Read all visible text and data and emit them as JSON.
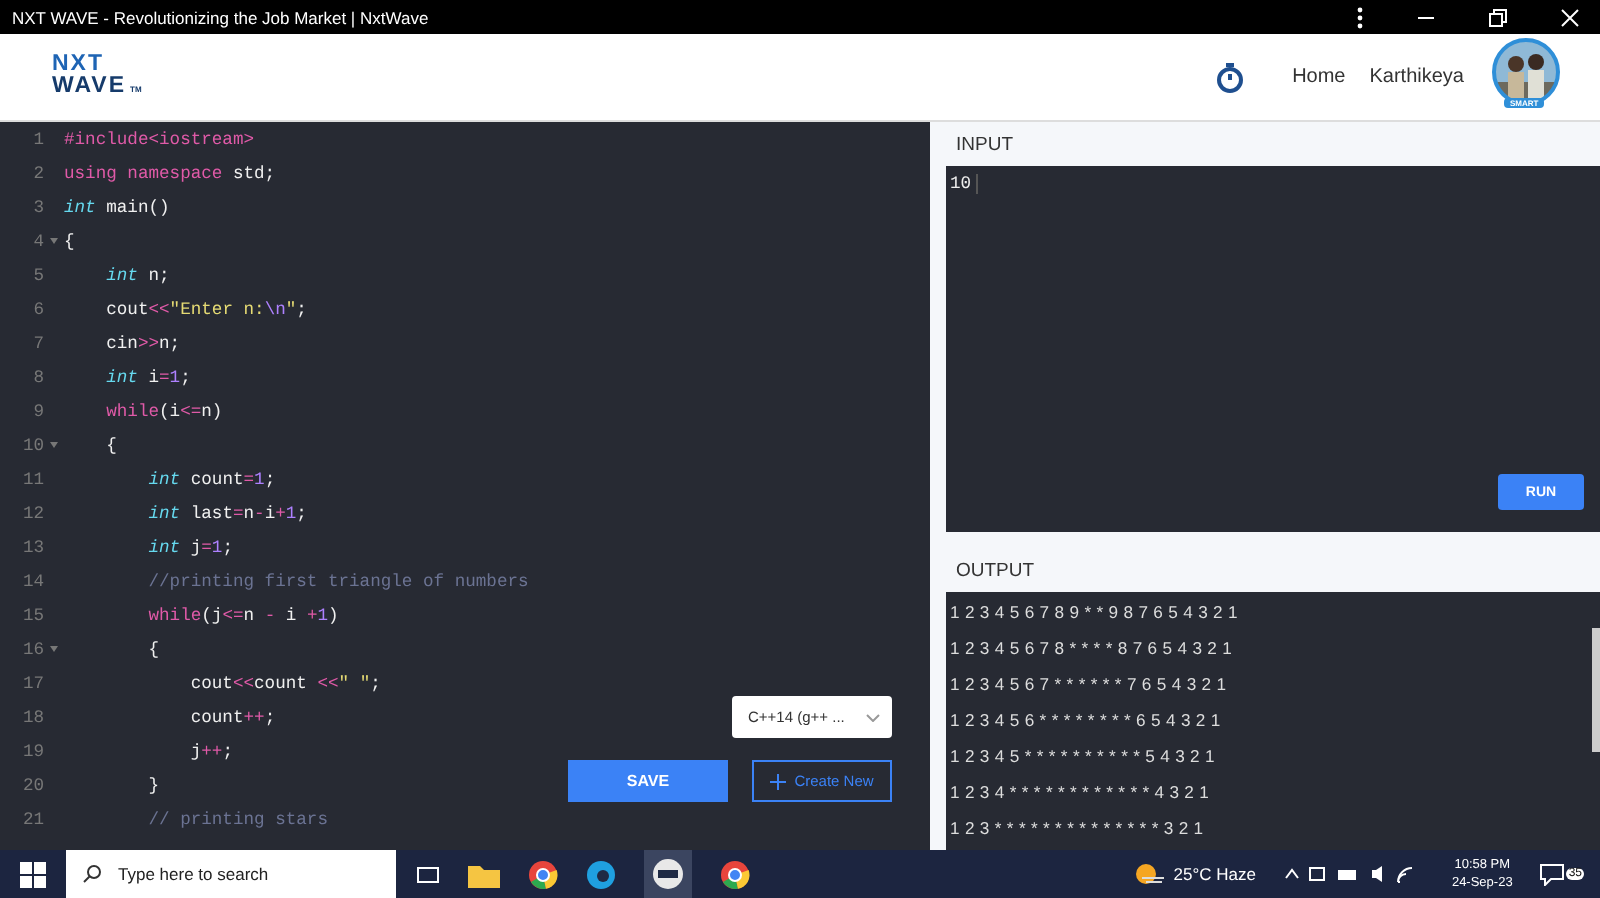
{
  "window": {
    "title": "NXT WAVE - Revolutionizing the Job Market | NxtWave"
  },
  "header": {
    "logo": {
      "line_1": "NXT",
      "line_2": "WAVE",
      "mark": "TM"
    },
    "nav": [
      "Home",
      "Karthikeya"
    ],
    "avatar": {
      "badge": "SMART"
    }
  },
  "editor": {
    "lines": [
      {
        "number": "1",
        "fold": false,
        "tokens": [
          {
            "kind": "pre",
            "t": "#include<iostream>"
          }
        ]
      },
      {
        "number": "2",
        "fold": false,
        "tokens": [
          {
            "kind": "kw",
            "t": "using namespace"
          },
          {
            "kind": "plain",
            "t": " std;"
          }
        ]
      },
      {
        "number": "3",
        "fold": false,
        "tokens": [
          {
            "kind": "type",
            "t": "int"
          },
          {
            "kind": "plain",
            "t": " main()"
          }
        ]
      },
      {
        "number": "4",
        "fold": true,
        "tokens": [
          {
            "kind": "plain",
            "t": "{"
          }
        ]
      },
      {
        "number": "5",
        "fold": false,
        "tokens": [
          {
            "kind": "type",
            "t": "    int"
          },
          {
            "kind": "plain",
            "t": " n;"
          }
        ]
      },
      {
        "number": "6",
        "fold": false,
        "tokens": [
          {
            "kind": "plain",
            "t": "    cout"
          },
          {
            "kind": "op",
            "t": "<<"
          },
          {
            "kind": "str",
            "t": "\"Enter n:"
          },
          {
            "kind": "esc",
            "t": "\\n"
          },
          {
            "kind": "str",
            "t": "\""
          },
          {
            "kind": "plain",
            "t": ";"
          }
        ]
      },
      {
        "number": "7",
        "fold": false,
        "tokens": [
          {
            "kind": "plain",
            "t": "    cin"
          },
          {
            "kind": "op",
            "t": ">>"
          },
          {
            "kind": "plain",
            "t": "n;"
          }
        ]
      },
      {
        "number": "8",
        "fold": false,
        "tokens": [
          {
            "kind": "type",
            "t": "    int"
          },
          {
            "kind": "plain",
            "t": " i"
          },
          {
            "kind": "op",
            "t": "="
          },
          {
            "kind": "num",
            "t": "1"
          },
          {
            "kind": "plain",
            "t": ";"
          }
        ]
      },
      {
        "number": "9",
        "fold": false,
        "tokens": [
          {
            "kind": "kw",
            "t": "    while"
          },
          {
            "kind": "plain",
            "t": "(i"
          },
          {
            "kind": "op",
            "t": "<="
          },
          {
            "kind": "plain",
            "t": "n)"
          }
        ]
      },
      {
        "number": "10",
        "fold": true,
        "tokens": [
          {
            "kind": "plain",
            "t": "    {"
          }
        ]
      },
      {
        "number": "11",
        "fold": false,
        "tokens": [
          {
            "kind": "type",
            "t": "        int"
          },
          {
            "kind": "plain",
            "t": " count"
          },
          {
            "kind": "op",
            "t": "="
          },
          {
            "kind": "num",
            "t": "1"
          },
          {
            "kind": "plain",
            "t": ";"
          }
        ]
      },
      {
        "number": "12",
        "fold": false,
        "tokens": [
          {
            "kind": "type",
            "t": "        int"
          },
          {
            "kind": "plain",
            "t": " last"
          },
          {
            "kind": "op",
            "t": "="
          },
          {
            "kind": "plain",
            "t": "n"
          },
          {
            "kind": "op",
            "t": "-"
          },
          {
            "kind": "plain",
            "t": "i"
          },
          {
            "kind": "op",
            "t": "+"
          },
          {
            "kind": "num",
            "t": "1"
          },
          {
            "kind": "plain",
            "t": ";"
          }
        ]
      },
      {
        "number": "13",
        "fold": false,
        "tokens": [
          {
            "kind": "type",
            "t": "        int"
          },
          {
            "kind": "plain",
            "t": " j"
          },
          {
            "kind": "op",
            "t": "="
          },
          {
            "kind": "num",
            "t": "1"
          },
          {
            "kind": "plain",
            "t": ";"
          }
        ]
      },
      {
        "number": "14",
        "fold": false,
        "tokens": [
          {
            "kind": "comment",
            "t": "        //printing first triangle of numbers"
          }
        ]
      },
      {
        "number": "15",
        "fold": false,
        "tokens": [
          {
            "kind": "kw",
            "t": "        while"
          },
          {
            "kind": "plain",
            "t": "(j"
          },
          {
            "kind": "op",
            "t": "<="
          },
          {
            "kind": "plain",
            "t": "n "
          },
          {
            "kind": "op",
            "t": "-"
          },
          {
            "kind": "plain",
            "t": " i "
          },
          {
            "kind": "op",
            "t": "+"
          },
          {
            "kind": "num",
            "t": "1"
          },
          {
            "kind": "plain",
            "t": ")"
          }
        ]
      },
      {
        "number": "16",
        "fold": true,
        "tokens": [
          {
            "kind": "plain",
            "t": "        {"
          }
        ]
      },
      {
        "number": "17",
        "fold": false,
        "tokens": [
          {
            "kind": "plain",
            "t": "            cout"
          },
          {
            "kind": "op",
            "t": "<<"
          },
          {
            "kind": "plain",
            "t": "count "
          },
          {
            "kind": "op",
            "t": "<<"
          },
          {
            "kind": "str",
            "t": "\" \""
          },
          {
            "kind": "plain",
            "t": ";"
          }
        ]
      },
      {
        "number": "18",
        "fold": false,
        "tokens": [
          {
            "kind": "plain",
            "t": "            count"
          },
          {
            "kind": "op",
            "t": "++"
          },
          {
            "kind": "plain",
            "t": ";"
          }
        ]
      },
      {
        "number": "19",
        "fold": false,
        "tokens": [
          {
            "kind": "plain",
            "t": "            j"
          },
          {
            "kind": "op",
            "t": "++"
          },
          {
            "kind": "plain",
            "t": ";"
          }
        ]
      },
      {
        "number": "20",
        "fold": false,
        "tokens": [
          {
            "kind": "plain",
            "t": "        }"
          }
        ]
      },
      {
        "number": "21",
        "fold": false,
        "tokens": [
          {
            "kind": "comment",
            "t": "        // printing stars"
          }
        ]
      }
    ],
    "language": "C++14 (g++ ...",
    "buttons": {
      "save": "SAVE",
      "create": "Create New"
    }
  },
  "input": {
    "title": "INPUT",
    "value": "10",
    "run": "RUN"
  },
  "output": {
    "title": "OUTPUT",
    "rows": [
      "1 2 3 4 5 6 7 8 9 * * 9 8 7 6 5 4 3 2 1",
      "1 2 3 4 5 6 7 8 * * * * 8 7 6 5 4 3 2 1",
      "1 2 3 4 5 6 7 * * * * * * 7 6 5 4 3 2 1",
      "1 2 3 4 5 6 * * * * * * * * 6 5 4 3 2 1",
      "1 2 3 4 5 * * * * * * * * * * 5 4 3 2 1",
      "1 2 3 4 * * * * * * * * * * * * 4 3 2 1",
      "1 2 3 * * * * * * * * * * * * * * 3 2 1"
    ]
  },
  "taskbar": {
    "search": {
      "placeholder": "Type here to search"
    },
    "weather": "25°C  Haze",
    "time": "10:58 PM",
    "date": "24-Sep-23",
    "notifications": "35"
  }
}
